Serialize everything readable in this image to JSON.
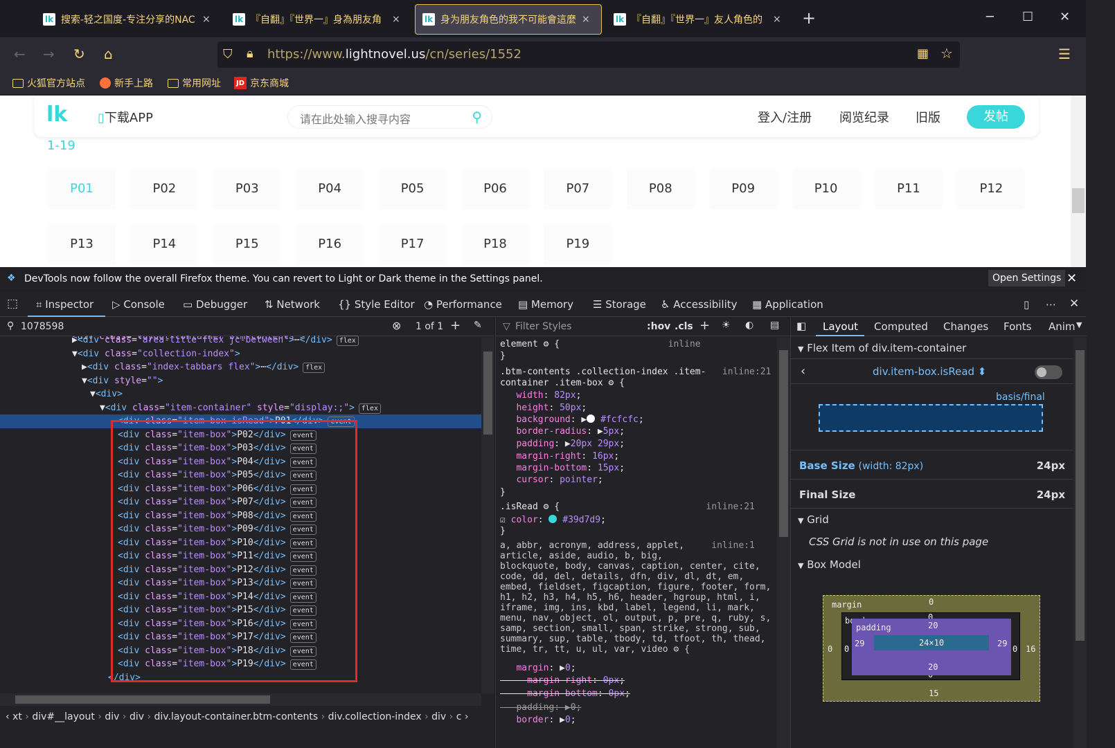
{
  "tabs": [
    {
      "label": "搜索-轻之国度-专注分享的NAC",
      "close": "×"
    },
    {
      "label": "『自翻』『世界一』身為朋友角",
      "close": "×"
    },
    {
      "label": "身为朋友角色的我不可能會這麼",
      "close": "×"
    },
    {
      "label": "『自翻』『世界一』友人角色的",
      "close": "×"
    }
  ],
  "new_tab": "+",
  "url": {
    "prefix": "https://www.",
    "domain": "lightnovel.us",
    "path": "/cn/series/1552"
  },
  "bookmarks": [
    "火狐官方站点",
    "新手上路",
    "常用网址",
    "京东商城"
  ],
  "site": {
    "download": "下载APP",
    "search_placeholder": "请在此处输入搜寻内容",
    "login": "登入/注册",
    "history": "阅览纪录",
    "old": "旧版",
    "post": "发帖",
    "range": "1-19",
    "items": [
      "P01",
      "P02",
      "P03",
      "P04",
      "P05",
      "P06",
      "P07",
      "P08",
      "P09",
      "P10",
      "P11",
      "P12",
      "P13",
      "P14",
      "P15",
      "P16",
      "P17",
      "P18",
      "P19"
    ]
  },
  "notification": {
    "text": "DevTools now follow the overall Firefox theme. You can revert to Light or Dark theme in the Settings panel.",
    "button": "Open Settings"
  },
  "devtools_tabs": [
    "Inspector",
    "Console",
    "Debugger",
    "Network",
    "Style Editor",
    "Performance",
    "Memory",
    "Storage",
    "Accessibility",
    "Application"
  ],
  "inspector": {
    "search": "1078598",
    "count": "1 of 1",
    "breadcrumbs": [
      "xt",
      "div#__layout",
      "div",
      "div",
      "div.layout-container.btm-contents",
      "div.collection-index",
      "div",
      "c"
    ]
  },
  "styles": {
    "filter": "Filter Styles",
    "hov": ":hov",
    "cls": ".cls"
  },
  "right_tabs": [
    "Layout",
    "Computed",
    "Changes",
    "Fonts",
    "Anim"
  ],
  "layout": {
    "flex_title": "Flex Item of div.item-container",
    "element": "div.item-box.isRead",
    "basis": "basis/final",
    "base_size_label": "Base Size",
    "base_size_note": "(width: 82px)",
    "base_size": "24px",
    "final_size_label": "Final Size",
    "final_size": "24px",
    "grid": "Grid",
    "grid_note": "CSS Grid is not in use on this page",
    "box_model": "Box Model",
    "bm": {
      "margin": "margin",
      "border": "border",
      "padding": "padding",
      "content": "24×10",
      "mt": "0",
      "bt": "0",
      "pt": "20",
      "pb": "20",
      "bb": "0",
      "mb": "15",
      "ml": "0",
      "bl": "0",
      "pl": "29",
      "pr": "29",
      "br": "0",
      "mr": "16"
    }
  }
}
